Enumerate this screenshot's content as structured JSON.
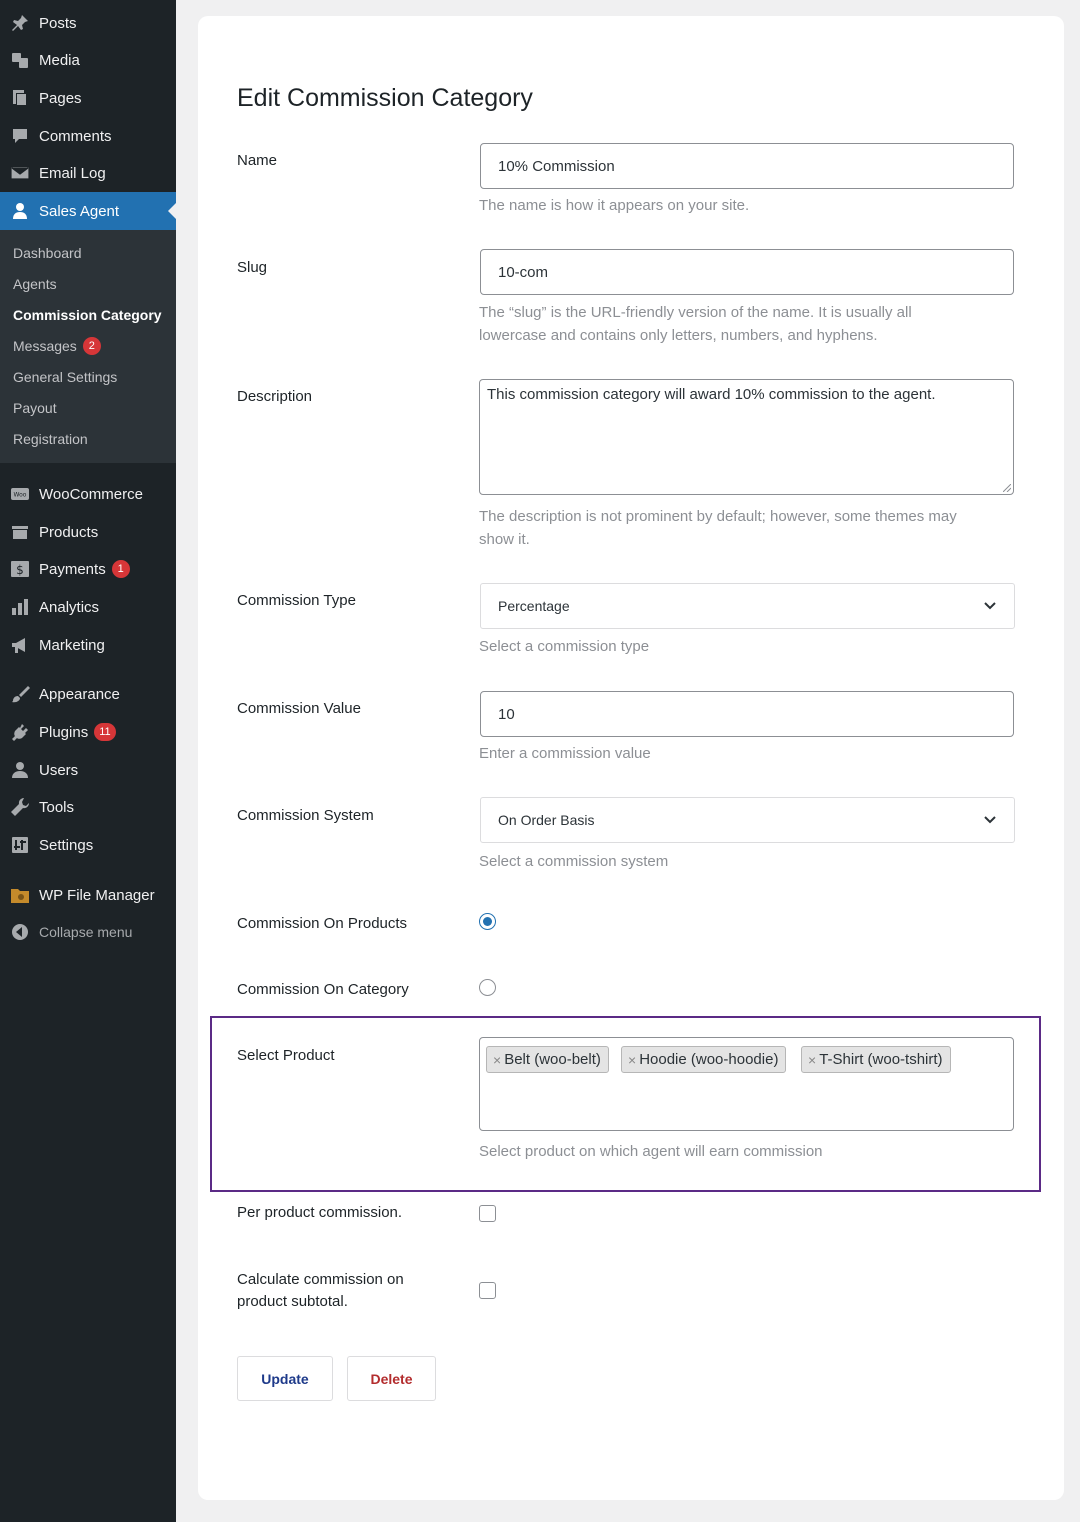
{
  "sidebar": {
    "top_items": [
      {
        "label": "Posts",
        "icon": "pin-icon"
      },
      {
        "label": "Media",
        "icon": "media-icon"
      },
      {
        "label": "Pages",
        "icon": "pages-icon"
      },
      {
        "label": "Comments",
        "icon": "comment-icon"
      },
      {
        "label": "Email Log",
        "icon": "email-icon"
      },
      {
        "label": "Sales Agent",
        "icon": "agent-icon"
      }
    ],
    "submenu": [
      {
        "label": "Dashboard"
      },
      {
        "label": "Agents"
      },
      {
        "label": "Commission Category"
      },
      {
        "label": "Messages",
        "badge": "2"
      },
      {
        "label": "General Settings"
      },
      {
        "label": "Payout"
      },
      {
        "label": "Registration"
      }
    ],
    "bottom_items": [
      {
        "label": "WooCommerce",
        "icon": "woo-icon"
      },
      {
        "label": "Products",
        "icon": "products-icon"
      },
      {
        "label": "Payments",
        "icon": "payments-icon",
        "badge": "1"
      },
      {
        "label": "Analytics",
        "icon": "analytics-icon"
      },
      {
        "label": "Marketing",
        "icon": "megaphone-icon"
      },
      {
        "label": "Appearance",
        "icon": "brush-icon"
      },
      {
        "label": "Plugins",
        "icon": "plugin-icon",
        "badge": "11"
      },
      {
        "label": "Users",
        "icon": "user-icon"
      },
      {
        "label": "Tools",
        "icon": "wrench-icon"
      },
      {
        "label": "Settings",
        "icon": "settings-icon"
      },
      {
        "label": "WP File Manager",
        "icon": "folder-icon"
      }
    ],
    "collapse_label": "Collapse menu",
    "active_color": "#2271b1",
    "bg_color": "#1d2327"
  },
  "form": {
    "title": "Edit Commission Category",
    "name": {
      "label": "Name",
      "value": "10% Commission",
      "help": "The name is how it appears on your site."
    },
    "slug": {
      "label": "Slug",
      "value": "10-com",
      "help_line1": "The “slug” is the URL-friendly version of the name. It is usually all",
      "help_line2": "lowercase and contains only letters, numbers, and hyphens."
    },
    "description": {
      "label": "Description",
      "value": "This commission category will award 10% commission to the agent.",
      "help_line1": "The description is not prominent by default; however, some themes may",
      "help_line2": "show it."
    },
    "commission_type": {
      "label": "Commission Type",
      "value": "Percentage",
      "help": "Select a commission type"
    },
    "commission_value": {
      "label": "Commission Value",
      "value": "10",
      "help": "Enter a commission value"
    },
    "commission_system": {
      "label": "Commission System",
      "value": "On Order Basis",
      "help": "Select a commission system"
    },
    "on_products": {
      "label": "Commission On Products",
      "checked": true
    },
    "on_category": {
      "label": "Commission On Category",
      "checked": false
    },
    "select_product": {
      "label": "Select Product",
      "tokens": [
        "Belt (woo-belt)",
        "Hoodie (woo-hoodie)",
        "T-Shirt (woo-tshirt)"
      ],
      "remove_glyph": "×",
      "help": "Select product on which agent will earn commission",
      "highlight_color": "#5b2a86"
    },
    "per_product": {
      "label": "Per product commission.",
      "checked": false
    },
    "subtotal": {
      "label_line1": "Calculate commission on",
      "label_line2": "product subtotal.",
      "checked": false
    },
    "update_label": "Update",
    "delete_label": "Delete",
    "update_color": "#1e3a8a",
    "delete_color": "#b32d2e"
  }
}
